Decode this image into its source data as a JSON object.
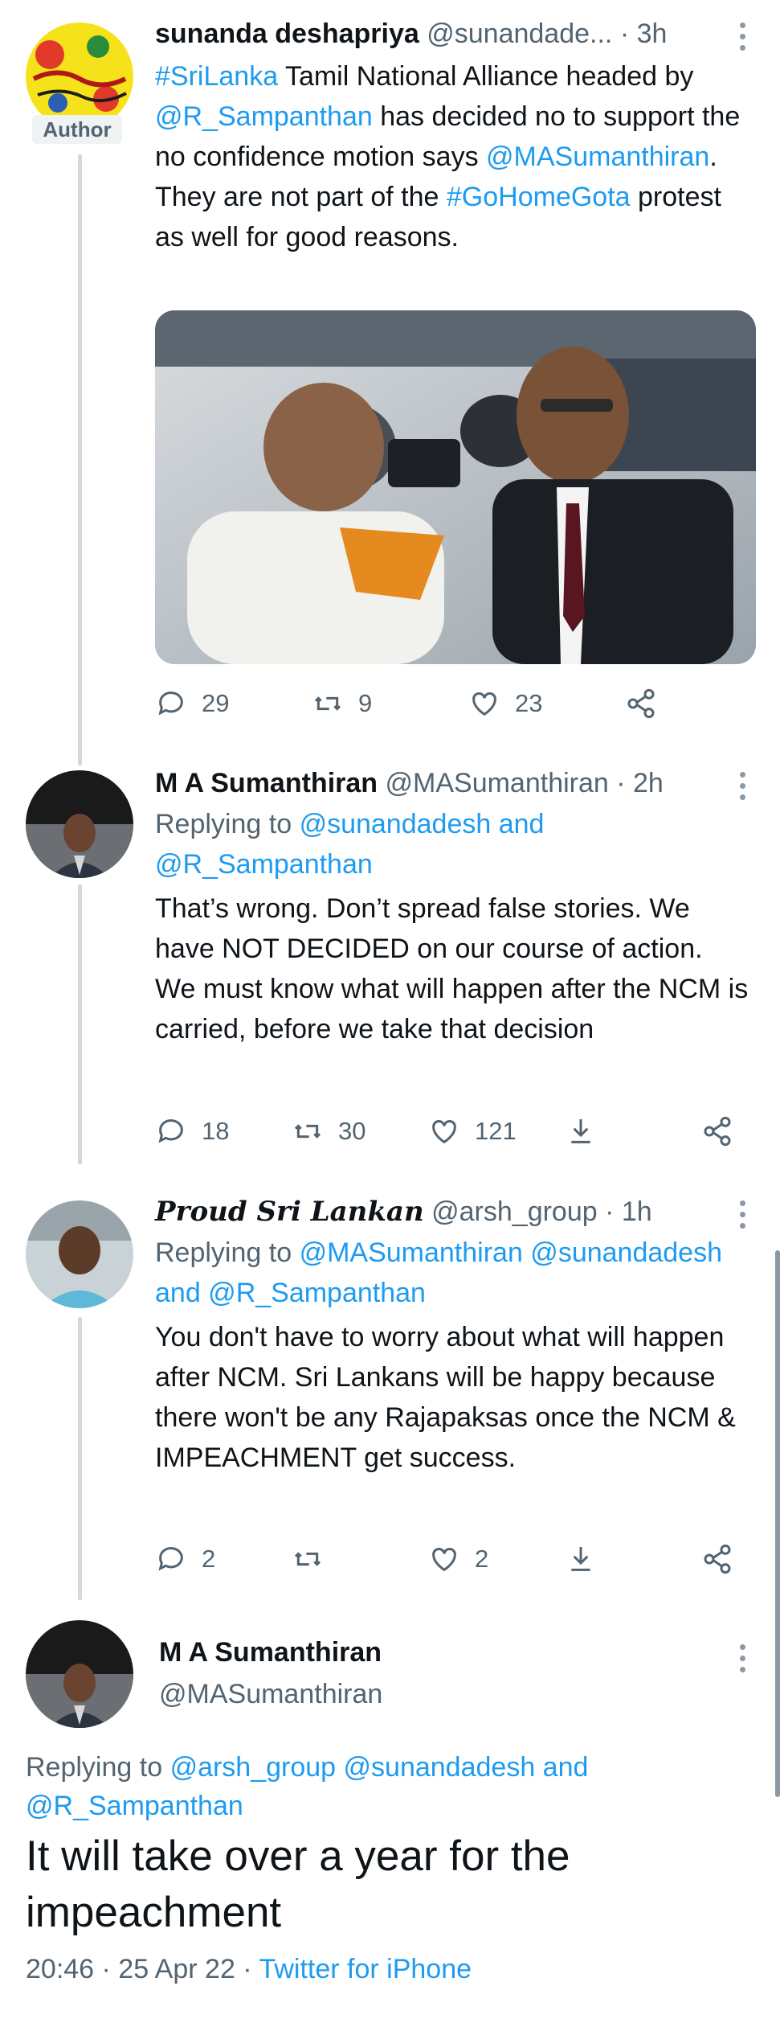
{
  "tweets": [
    {
      "name": "sunanda deshapriya",
      "handle": "@sunandade...",
      "time": "· 3h",
      "badge": "Author",
      "text_parts": {
        "t1": "#SriLanka",
        "t2": " Tamil National Alliance headed by ",
        "t3": "@R_Sampanthan",
        "t4": "  has decided no to support the no confidence motion says ",
        "t5": "@MASumanthiran",
        "t6": ".  They are not part of the ",
        "t7": "#GoHomeGota",
        "t8": " protest as well for good reasons."
      },
      "stats": {
        "replies": "29",
        "retweets": "9",
        "likes": "23"
      }
    },
    {
      "name": "M A Sumanthiran",
      "handle": "@MASumanthiran",
      "time": "· 2h",
      "replying_label": "Replying to",
      "replying_to": "@sunandadesh and @R_Sampanthan",
      "text": "That’s wrong. Don’t spread false stories. We have NOT DECIDED on our course of action. We must know what will happen after the NCM is carried, before we take that decision",
      "stats": {
        "replies": "18",
        "retweets": "30",
        "likes": "121"
      }
    },
    {
      "name": "Proud Sri Lankan",
      "handle": "@arsh_group",
      "time": "· 1h",
      "replying_label": "Replying to",
      "replying_to": "@MASumanthiran @sunandadesh and @R_Sampanthan",
      "text": "You don't have to worry about what will happen after NCM. Sri Lankans will be happy because there won't be any Rajapaksas once the NCM & IMPEACHMENT get success.",
      "stats": {
        "replies": "2",
        "retweets": "",
        "likes": "2"
      }
    }
  ],
  "main_tweet": {
    "name": "M A Sumanthiran",
    "handle": "@MASumanthiran",
    "replying_label": "Replying to",
    "replying_to": "@arsh_group @sunandadesh and @R_Sampanthan",
    "text": "It will take over a year for the impeachment",
    "timestamp": "20:46 · 25 Apr 22 · ",
    "source": "Twitter for iPhone"
  },
  "colors": {
    "link": "#1d9bf0",
    "muted": "#536471",
    "text": "#0f1419",
    "thread": "#cfd9de"
  },
  "icons": [
    "more-icon",
    "reply-icon",
    "retweet-icon",
    "like-icon",
    "share-icon",
    "bookmark-icon"
  ]
}
